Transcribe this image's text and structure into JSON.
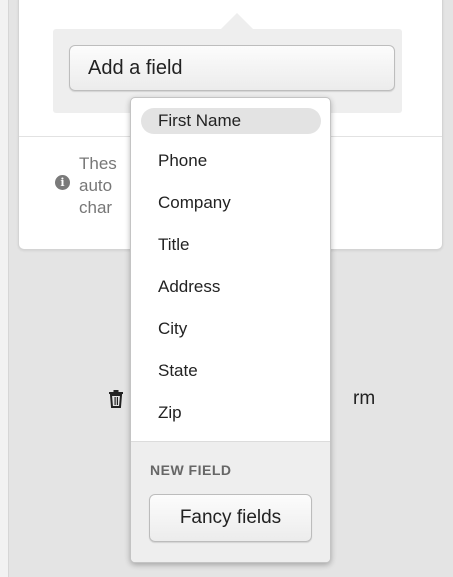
{
  "add_field_button": {
    "label": "Add a field"
  },
  "info": {
    "icon": "info-icon",
    "text_line_1": "Thes                                        d",
    "text_line_2": "auto                                        ake",
    "text_line_3": "char"
  },
  "delete_form": {
    "icon": "trash-icon",
    "label_tail": "rm"
  },
  "dropdown": {
    "items": [
      {
        "label": "First Name",
        "highlighted": true
      },
      {
        "label": "Phone"
      },
      {
        "label": "Company"
      },
      {
        "label": "Title"
      },
      {
        "label": "Address"
      },
      {
        "label": "City"
      },
      {
        "label": "State"
      },
      {
        "label": "Zip"
      }
    ],
    "new_field": {
      "heading": "NEW FIELD",
      "button_label": "Fancy fields"
    }
  },
  "colors": {
    "background": "#e4e4e4",
    "highlight": "#e3e3e3"
  }
}
